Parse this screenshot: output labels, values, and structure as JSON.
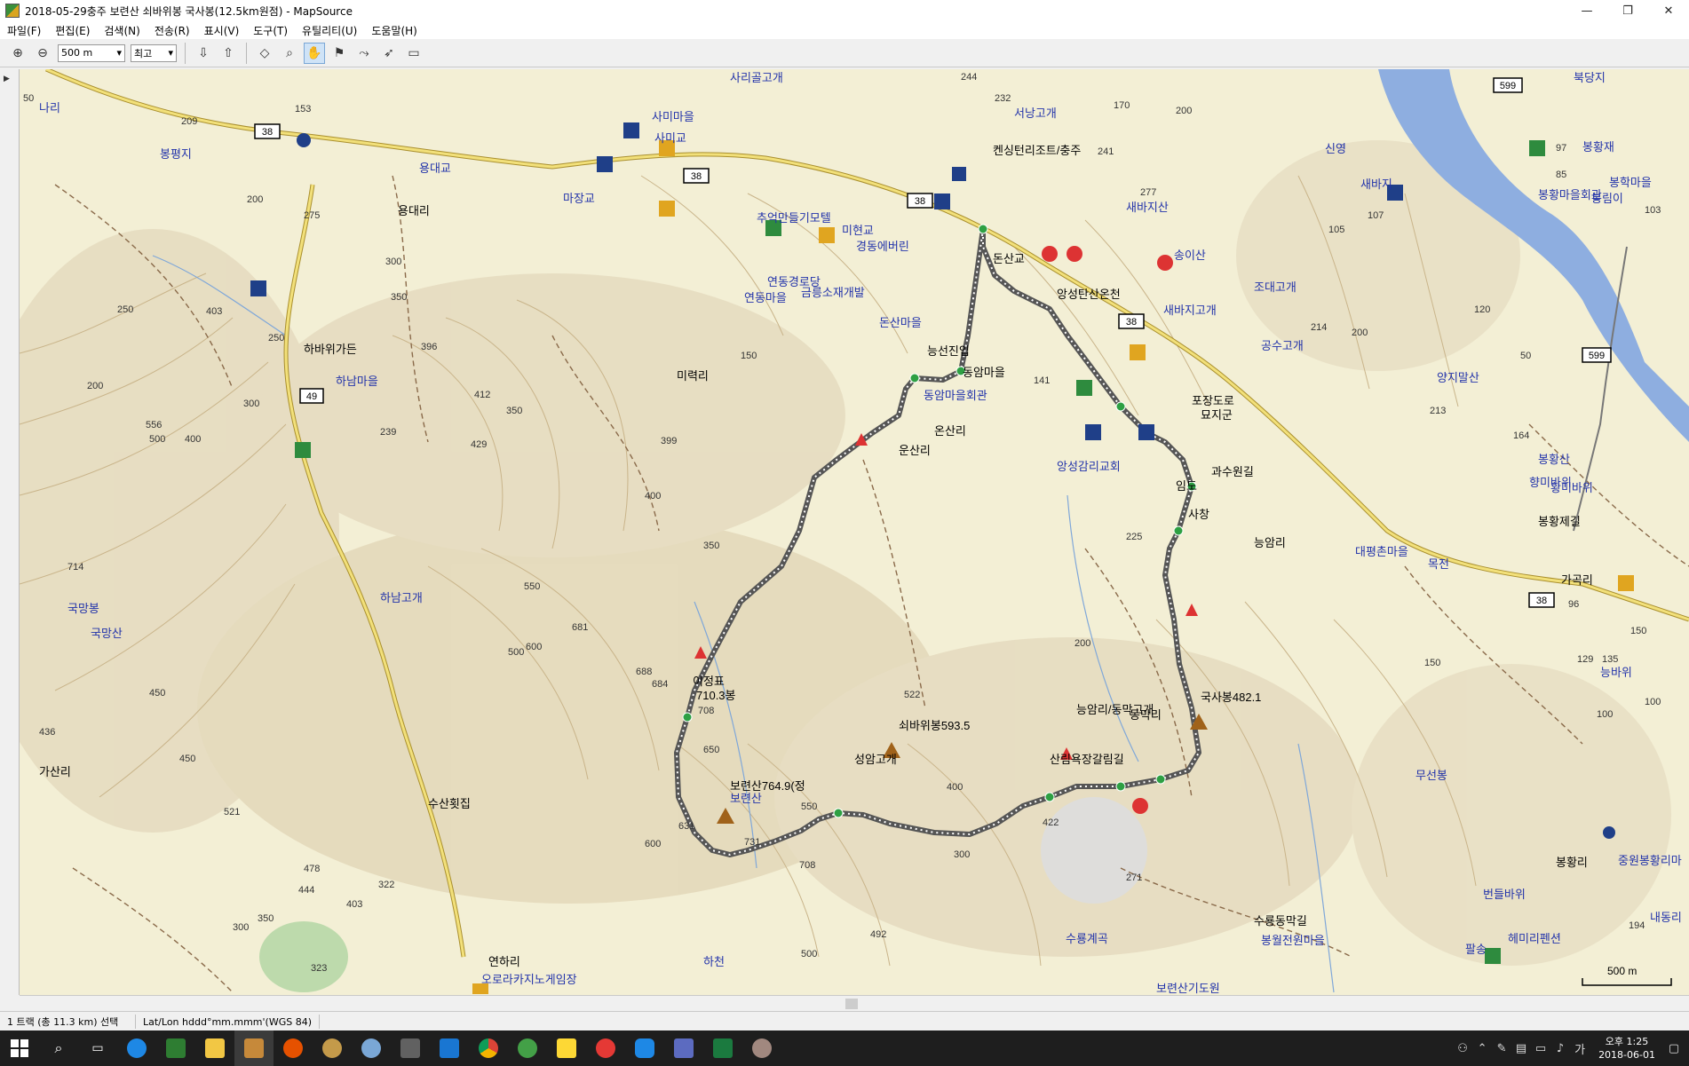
{
  "window": {
    "title": "2018-05-29충주 보련산 쇠바위봉 국사봉(12.5km원점) - MapSource",
    "minimize": "—",
    "restore": "❐",
    "close": "✕"
  },
  "menu": [
    "파일(F)",
    "편집(E)",
    "검색(N)",
    "전송(R)",
    "표시(V)",
    "도구(T)",
    "유틸리티(U)",
    "도움말(H)"
  ],
  "toolbar": {
    "scale_value": "500 m",
    "detail_value": "최고"
  },
  "map": {
    "background_color": "#f3efd5",
    "track_color": "#555555",
    "route_number_labels": [
      "38",
      "38",
      "38",
      "38",
      "38",
      "599",
      "599",
      "49"
    ],
    "labels": [
      "사리골고개",
      "사미마을",
      "사미교",
      "용대교",
      "마장교",
      "용대리",
      "봉평지",
      "나리",
      "추억만들기모텔",
      "미현교",
      "경동에버린",
      "연동경로당",
      "연동마을",
      "금릉소재개발",
      "돈산교",
      "돈산마을",
      "능선진입",
      "동암마을",
      "동암마을회관",
      "앙성탄산온천",
      "하바위가든",
      "하남마을",
      "미력리",
      "온산리",
      "앙성감리교회",
      "포장도로",
      "묘지군",
      "임도",
      "과수원길",
      "새바지산",
      "송이산",
      "조대고개",
      "공수고개",
      "신영",
      "새바지",
      "서낭고개",
      "켄싱턴리조트/충주",
      "새바지고개",
      "양지말산",
      "봉황산",
      "봉황제길",
      "봉황리",
      "가곡리",
      "대평촌마을",
      "목전",
      "이정표",
      "710.3봉",
      "보련산764.9(정",
      "보련산",
      "쇠바위봉593.5",
      "성암고개",
      "하남고개",
      "국망봉",
      "국망산",
      "수산횟집",
      "가산리",
      "능암리/동막고개",
      "산림욕장갈림길",
      "국사봉482.1",
      "수룡계곡",
      "수룡동막길",
      "봉월전원마을",
      "보련산기도원",
      "연하리",
      "오로라카지노게임장",
      "하천",
      "무선봉",
      "번들바위",
      "중원봉황리마",
      "내동리",
      "팔송",
      "헤미리펜션",
      "봉황마을회관",
      "봉학마을",
      "황미바위",
      "봉림이",
      "북당지",
      "능바위",
      "봉황재",
      "능암리",
      "사창",
      "운산리",
      "동막리",
      "향미바위"
    ],
    "elevations": [
      "50",
      "209",
      "153",
      "275",
      "200",
      "300",
      "350",
      "250",
      "403",
      "396",
      "412",
      "429",
      "350",
      "239",
      "300",
      "250",
      "200",
      "556",
      "500",
      "400",
      "714",
      "436",
      "450",
      "521",
      "478",
      "444",
      "403",
      "322",
      "323",
      "300",
      "350",
      "450",
      "500",
      "550",
      "600",
      "681",
      "688",
      "684",
      "708",
      "650",
      "600",
      "631",
      "731",
      "708",
      "550",
      "500",
      "492",
      "522",
      "400",
      "300",
      "422",
      "271",
      "200",
      "225",
      "141",
      "170",
      "232",
      "244",
      "241",
      "277",
      "200",
      "105",
      "107",
      "214",
      "200",
      "120",
      "213",
      "164",
      "50",
      "129",
      "135",
      "100",
      "194",
      "97",
      "85",
      "103",
      "150",
      "150",
      "100",
      "96",
      "399",
      "400",
      "350",
      "150"
    ],
    "scale_bar_label": "500 m"
  },
  "status": {
    "selection": "1 트랙 (총 11.3 km) 선택",
    "coord_format": "Lat/Lon hddd°mm.mmm'(WGS 84)"
  },
  "taskbar": {
    "time": "오후 1:25",
    "date": "2018-06-01",
    "ime": "가"
  }
}
